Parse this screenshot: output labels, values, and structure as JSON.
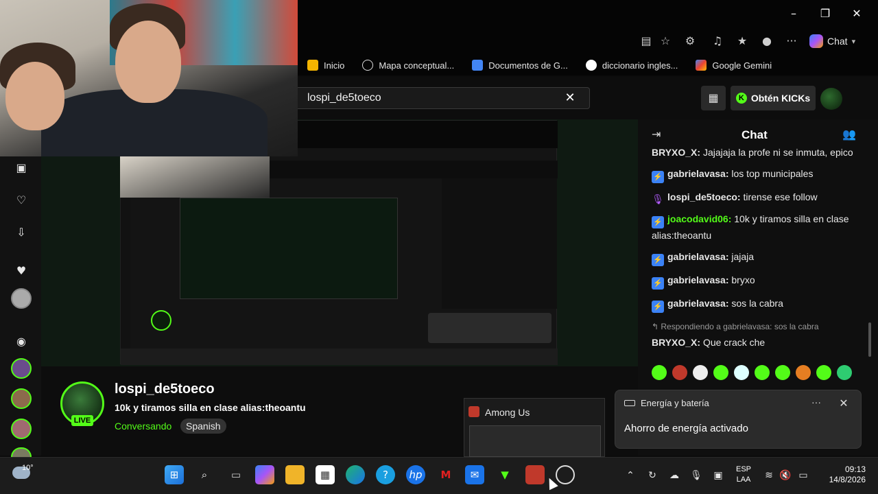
{
  "browser": {
    "copilot_label": "Chat",
    "bookmarks": [
      {
        "label": "Inicio",
        "color": "#f4b400"
      },
      {
        "label": "Mapa conceptual...",
        "color": "#dddddd"
      },
      {
        "label": "Documentos de G...",
        "color": "#4285f4"
      },
      {
        "label": "diccionario ingles...",
        "color": "#ea4335"
      },
      {
        "label": "Google Gemini",
        "color": "#8e7cff"
      }
    ]
  },
  "kick": {
    "search_value": "lospi_de5toeco",
    "kicks_label": "Obtén KICKs",
    "kicks_dot": "K"
  },
  "stream": {
    "streamer": "lospi_de5toeco",
    "title": "10k y tiramos silla en clase alias:theoantu",
    "category": "Conversando",
    "language": "Spanish",
    "live_label": "LIVE"
  },
  "chat": {
    "title": "Chat",
    "messages": [
      {
        "user": "BRYXO_X:",
        "text": " Jajajaja la profe ni se inmuta, epico",
        "badge": ""
      },
      {
        "user": "gabrielavasa:",
        "text": " los top municipales",
        "badge": "blue"
      },
      {
        "user": "lospi_de5toeco:",
        "text": " tirense ese follow",
        "badge": "mic"
      },
      {
        "user": "joacodavid06:",
        "text": " 10k y tiramos silla en clase alias:theoantu",
        "badge": "blue"
      },
      {
        "user": "gabrielavasa:",
        "text": " jajaja",
        "badge": "blue"
      },
      {
        "user": "gabrielavasa:",
        "text": " bryxo",
        "badge": "blue"
      },
      {
        "user": "gabrielavasa:",
        "text": " sos la cabra",
        "badge": "blue"
      }
    ],
    "reply_note": "Respondiendo a gabrielavasa: sos la cabra",
    "reply_user": "BRYXO_X:",
    "reply_text": " Que crack che",
    "user_colors": {
      "BRYXO_X:": "#ffffff",
      "gabrielavasa:": "#ffffff",
      "lospi_de5toeco:": "#ffffff",
      "joacodavid06:": "#53fc18"
    }
  },
  "popup": {
    "among_us_title": "Among Us"
  },
  "toast": {
    "title": "Energía y batería",
    "more": "···",
    "body": "Ahorro de energía activado"
  },
  "taskbar": {
    "temp": "10°",
    "lang_line1": "ESP",
    "lang_line2": "LAA",
    "time": "09:13",
    "date": "14/8/2026"
  },
  "colors": {
    "accent": "#53fc18",
    "badge_blue": "#3b82f6"
  }
}
